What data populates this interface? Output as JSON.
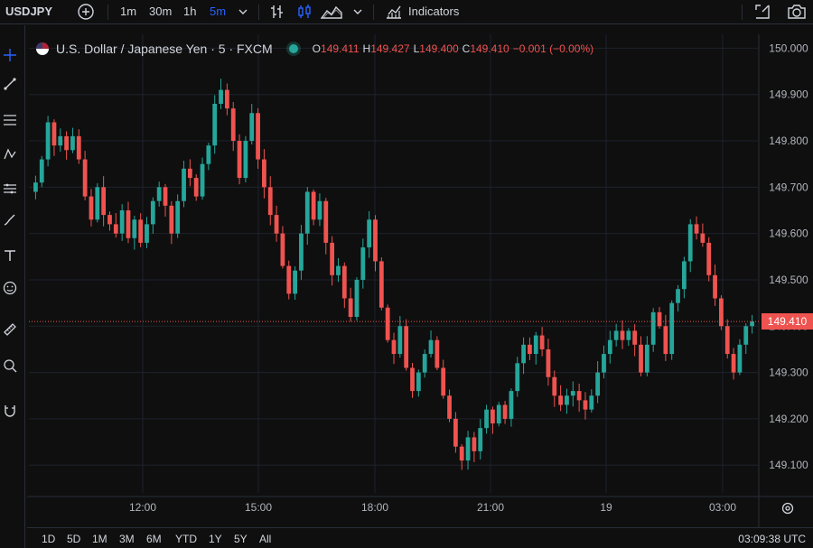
{
  "toolbar": {
    "symbol": "USDJPY",
    "timeframes": [
      "1m",
      "30m",
      "1h",
      "5m"
    ],
    "active_timeframe": "5m",
    "indicators_label": "Indicators"
  },
  "legend": {
    "title": "U.S. Dollar / Japanese Yen · 5 · FXCM",
    "open_label": "O",
    "open": "149.411",
    "high_label": "H",
    "high": "149.427",
    "low_label": "L",
    "low": "149.400",
    "close_label": "C",
    "close": "149.410",
    "change": "−0.001 (−0.00%)"
  },
  "bottom": {
    "ranges": [
      "1D",
      "5D",
      "1M",
      "3M",
      "6M",
      "YTD",
      "1Y",
      "5Y",
      "All"
    ],
    "clock": "03:09:38 UTC"
  },
  "colors": {
    "up": "#26a69a",
    "down": "#ef5350",
    "accent": "#2962ff",
    "grid": "#1e222d"
  },
  "chart_data": {
    "type": "candlestick",
    "y_ticks": [
      "150.000",
      "149.900",
      "149.800",
      "149.700",
      "149.600",
      "149.500",
      "149.400",
      "149.300",
      "149.200",
      "149.100"
    ],
    "ylim": [
      149.04,
      150.03
    ],
    "x_ticks": [
      "12:00",
      "15:00",
      "18:00",
      "21:00",
      "19",
      "03:00"
    ],
    "last_price": "149.410",
    "series": [
      {
        "name": "",
        "values": [
          149.71,
          149.76,
          149.84,
          149.79,
          149.81,
          149.78,
          149.81,
          149.76,
          149.68,
          149.63,
          149.7,
          149.64,
          149.62,
          149.6,
          149.65,
          149.59,
          149.63,
          149.58,
          149.62,
          149.67,
          149.7,
          149.66,
          149.6,
          149.67,
          149.74,
          149.72,
          149.68,
          149.75,
          149.79,
          149.88,
          149.91,
          149.87,
          149.8,
          149.72,
          149.8,
          149.86,
          149.76,
          149.7,
          149.64,
          149.6,
          149.53,
          149.47,
          149.52,
          149.6,
          149.69,
          149.63,
          149.67,
          149.58,
          149.51,
          149.53,
          149.46,
          149.42,
          149.5,
          149.57,
          149.63,
          149.54,
          149.44,
          149.37,
          149.34,
          149.4,
          149.31,
          149.26,
          149.3,
          149.34,
          149.37,
          149.31,
          149.25,
          149.2,
          149.14,
          149.11,
          149.16,
          149.13,
          149.18,
          149.22,
          149.19,
          149.23,
          149.2,
          149.26,
          149.32,
          149.36,
          149.34,
          149.38,
          149.35,
          149.29,
          149.25,
          149.23,
          149.25,
          149.26,
          149.24,
          149.22,
          149.25,
          149.3,
          149.34,
          149.37,
          149.39,
          149.37,
          149.39,
          149.36,
          149.3,
          149.36,
          149.43,
          149.4,
          149.34,
          149.45,
          149.48,
          149.54,
          149.62,
          149.6,
          149.58,
          149.51,
          149.46,
          149.4,
          149.34,
          149.3,
          149.36,
          149.4,
          149.41
        ]
      }
    ]
  }
}
